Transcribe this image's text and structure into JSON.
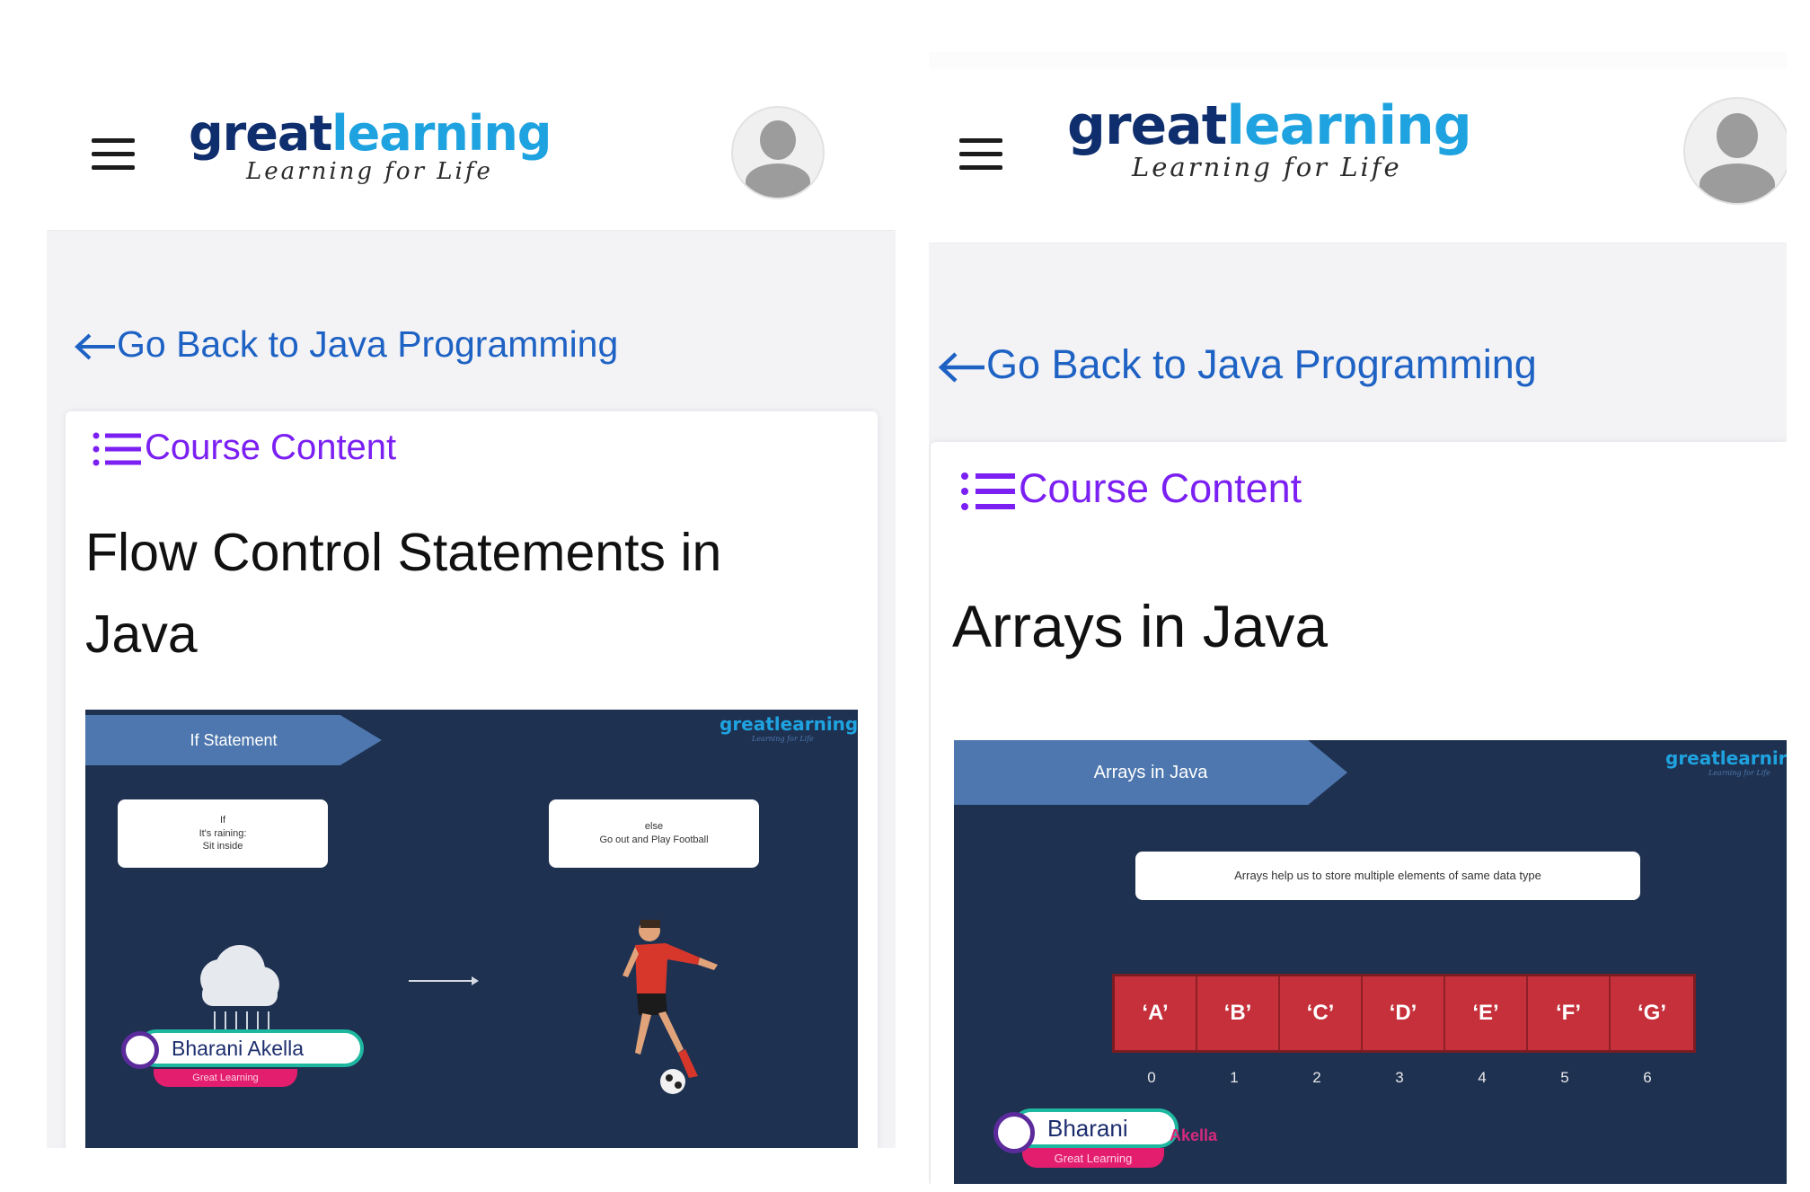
{
  "left": {
    "header": {
      "logo_main_a": "great",
      "logo_main_b": "learning",
      "logo_tag": "Learning for Life"
    },
    "back_link": "Go Back to Java Programming",
    "course_content": "Course Content",
    "title": "Flow Control Statements in Java",
    "video": {
      "ribbon": "If Statement",
      "logo": "greatlearning",
      "logo_tag": "Learning for Life",
      "if_box": [
        "If",
        "It's raining:",
        "Sit inside"
      ],
      "else_box": [
        "else",
        "Go out and Play Football"
      ],
      "presenter": "Bharani Akella",
      "presenter_org": "Great Learning"
    }
  },
  "right": {
    "header": {
      "logo_main_a": "great",
      "logo_main_b": "learning",
      "logo_tag": "Learning for Life"
    },
    "back_link": "Go Back to Java Programming",
    "course_content": "Course Content",
    "title": "Arrays in Java",
    "video": {
      "ribbon": "Arrays in Java",
      "logo": "greatlearnir",
      "logo_tag": "Learning for Life",
      "description": "Arrays help us to store multiple elements of same data type",
      "cells": [
        "‘A’",
        "‘B’",
        "‘C’",
        "‘D’",
        "‘E’",
        "‘F’",
        "‘G’"
      ],
      "indices": [
        "0",
        "1",
        "2",
        "3",
        "4",
        "5",
        "6"
      ],
      "presenter": "Bharani",
      "presenter_overlay": "Akella",
      "presenter_org": "Great Learning"
    }
  }
}
